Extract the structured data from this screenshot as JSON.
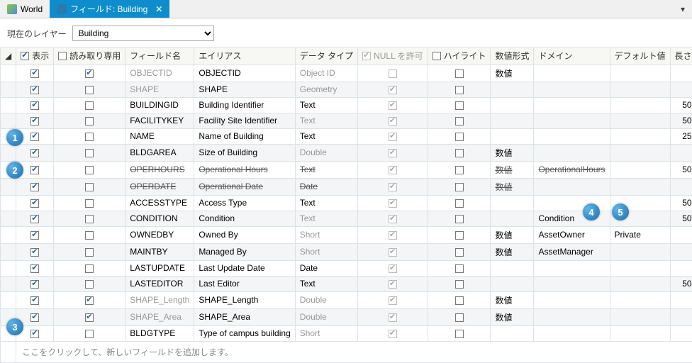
{
  "tabs": {
    "world": "World",
    "fields": "フィールド: Building",
    "close": "✕"
  },
  "toolbar": {
    "label": "現在のレイヤー",
    "value": "Building"
  },
  "headers": {
    "visible": "表示",
    "readonly": "読み取り専用",
    "fieldname": "フィールド名",
    "alias": "エイリアス",
    "datatype": "データ タイプ",
    "nullable": "NULL を許可",
    "highlight": "ハイライト",
    "numfmt": "数値形式",
    "domain": "ドメイン",
    "default": "デフォルト値",
    "length": "長さ"
  },
  "rows": [
    {
      "visible": true,
      "readonly": true,
      "fieldname": "OBJECTID",
      "fnGray": true,
      "alias": "OBJECTID",
      "datatype": "Object ID",
      "dtGray": true,
      "nullable": false,
      "nullDim": true,
      "highlight": false,
      "numfmt": "数値",
      "domain": "",
      "default": "",
      "length": ""
    },
    {
      "visible": true,
      "readonly": false,
      "fieldname": "SHAPE",
      "fnGray": true,
      "alias": "SHAPE",
      "datatype": "Geometry",
      "dtGray": true,
      "nullable": true,
      "nullDim": true,
      "highlight": false,
      "numfmt": "",
      "domain": "",
      "default": "",
      "length": ""
    },
    {
      "visible": true,
      "readonly": false,
      "fieldname": "BUILDINGID",
      "alias": "Building Identifier",
      "datatype": "Text",
      "nullable": true,
      "nullDim": true,
      "highlight": false,
      "numfmt": "",
      "domain": "",
      "default": "",
      "length": "50"
    },
    {
      "visible": true,
      "readonly": false,
      "fieldname": "FACILITYKEY",
      "alias": "Facility Site Identifier",
      "datatype": "Text",
      "dtGray": true,
      "nullable": true,
      "nullDim": true,
      "highlight": false,
      "numfmt": "",
      "domain": "",
      "default": "",
      "length": "50"
    },
    {
      "visible": true,
      "readonly": false,
      "fieldname": "NAME",
      "alias": "Name of Building",
      "datatype": "Text",
      "nullable": true,
      "nullDim": true,
      "highlight": false,
      "numfmt": "",
      "domain": "",
      "default": "",
      "length": "25"
    },
    {
      "visible": true,
      "readonly": false,
      "fieldname": "BLDGAREA",
      "alias": "Size of Building",
      "datatype": "Double",
      "dtGray": true,
      "nullable": true,
      "nullDim": true,
      "highlight": false,
      "numfmt": "数値",
      "domain": "",
      "default": "",
      "length": ""
    },
    {
      "visible": true,
      "readonly": false,
      "fieldname": "OPERHOURS",
      "strike": true,
      "alias": "Operational Hours",
      "datatype": "Text",
      "nullable": true,
      "nullDim": true,
      "highlight": false,
      "numfmt": "数値",
      "numStrike": true,
      "domain": "OperationalHours",
      "domStrike": true,
      "default": "",
      "length": "50"
    },
    {
      "visible": true,
      "readonly": false,
      "fieldname": "OPERDATE",
      "strike": true,
      "alias": "Operational Date",
      "datatype": "Date",
      "nullable": true,
      "nullDim": true,
      "highlight": false,
      "numfmt": "数値",
      "numStrike": true,
      "domain": "",
      "default": "",
      "length": ""
    },
    {
      "visible": true,
      "readonly": false,
      "fieldname": "ACCESSTYPE",
      "alias": "Access Type",
      "datatype": "Text",
      "nullable": true,
      "nullDim": true,
      "highlight": false,
      "numfmt": "",
      "domain": "",
      "default": "",
      "length": "50"
    },
    {
      "visible": true,
      "readonly": false,
      "fieldname": "CONDITION",
      "alias": "Condition",
      "datatype": "Text",
      "dtGray": true,
      "nullable": true,
      "nullDim": true,
      "highlight": false,
      "numfmt": "",
      "domain": "Condition",
      "default": "",
      "length": "50"
    },
    {
      "visible": true,
      "readonly": false,
      "fieldname": "OWNEDBY",
      "alias": "Owned By",
      "datatype": "Short",
      "dtGray": true,
      "nullable": true,
      "nullDim": true,
      "highlight": false,
      "numfmt": "数値",
      "domain": "AssetOwner",
      "default": "Private",
      "length": ""
    },
    {
      "visible": true,
      "readonly": false,
      "fieldname": "MAINTBY",
      "alias": "Managed By",
      "datatype": "Short",
      "dtGray": true,
      "nullable": true,
      "nullDim": true,
      "highlight": false,
      "numfmt": "数値",
      "domain": "AssetManager",
      "default": "",
      "length": ""
    },
    {
      "visible": true,
      "readonly": false,
      "fieldname": "LASTUPDATE",
      "alias": "Last Update Date",
      "datatype": "Date",
      "nullable": true,
      "nullDim": true,
      "highlight": false,
      "numfmt": "",
      "domain": "",
      "default": "",
      "length": ""
    },
    {
      "visible": true,
      "readonly": false,
      "fieldname": "LASTEDITOR",
      "alias": "Last Editor",
      "datatype": "Text",
      "nullable": true,
      "nullDim": true,
      "highlight": false,
      "numfmt": "",
      "domain": "",
      "default": "",
      "length": "50"
    },
    {
      "visible": true,
      "readonly": true,
      "fieldname": "SHAPE_Length",
      "fnGray": true,
      "alias": "SHAPE_Length",
      "datatype": "Double",
      "dtGray": true,
      "nullable": true,
      "nullDim": true,
      "highlight": false,
      "numfmt": "数値",
      "domain": "",
      "default": "",
      "length": ""
    },
    {
      "visible": true,
      "readonly": true,
      "fieldname": "SHAPE_Area",
      "fnGray": true,
      "alias": "SHAPE_Area",
      "datatype": "Double",
      "dtGray": true,
      "nullable": true,
      "nullDim": true,
      "highlight": false,
      "numfmt": "数値",
      "domain": "",
      "default": "",
      "length": ""
    },
    {
      "visible": true,
      "readonly": false,
      "fieldname": "BLDGTYPE",
      "alias": "Type of campus building",
      "datatype": "Short",
      "dtGray": true,
      "nullable": true,
      "nullDim": true,
      "highlight": false,
      "numfmt": "",
      "domain": "",
      "default": "",
      "length": ""
    }
  ],
  "footer": "ここをクリックして、新しいフィールドを追加します。",
  "callouts": {
    "c1": "1",
    "c2": "2",
    "c3": "3",
    "c4": "4",
    "c5": "5"
  }
}
